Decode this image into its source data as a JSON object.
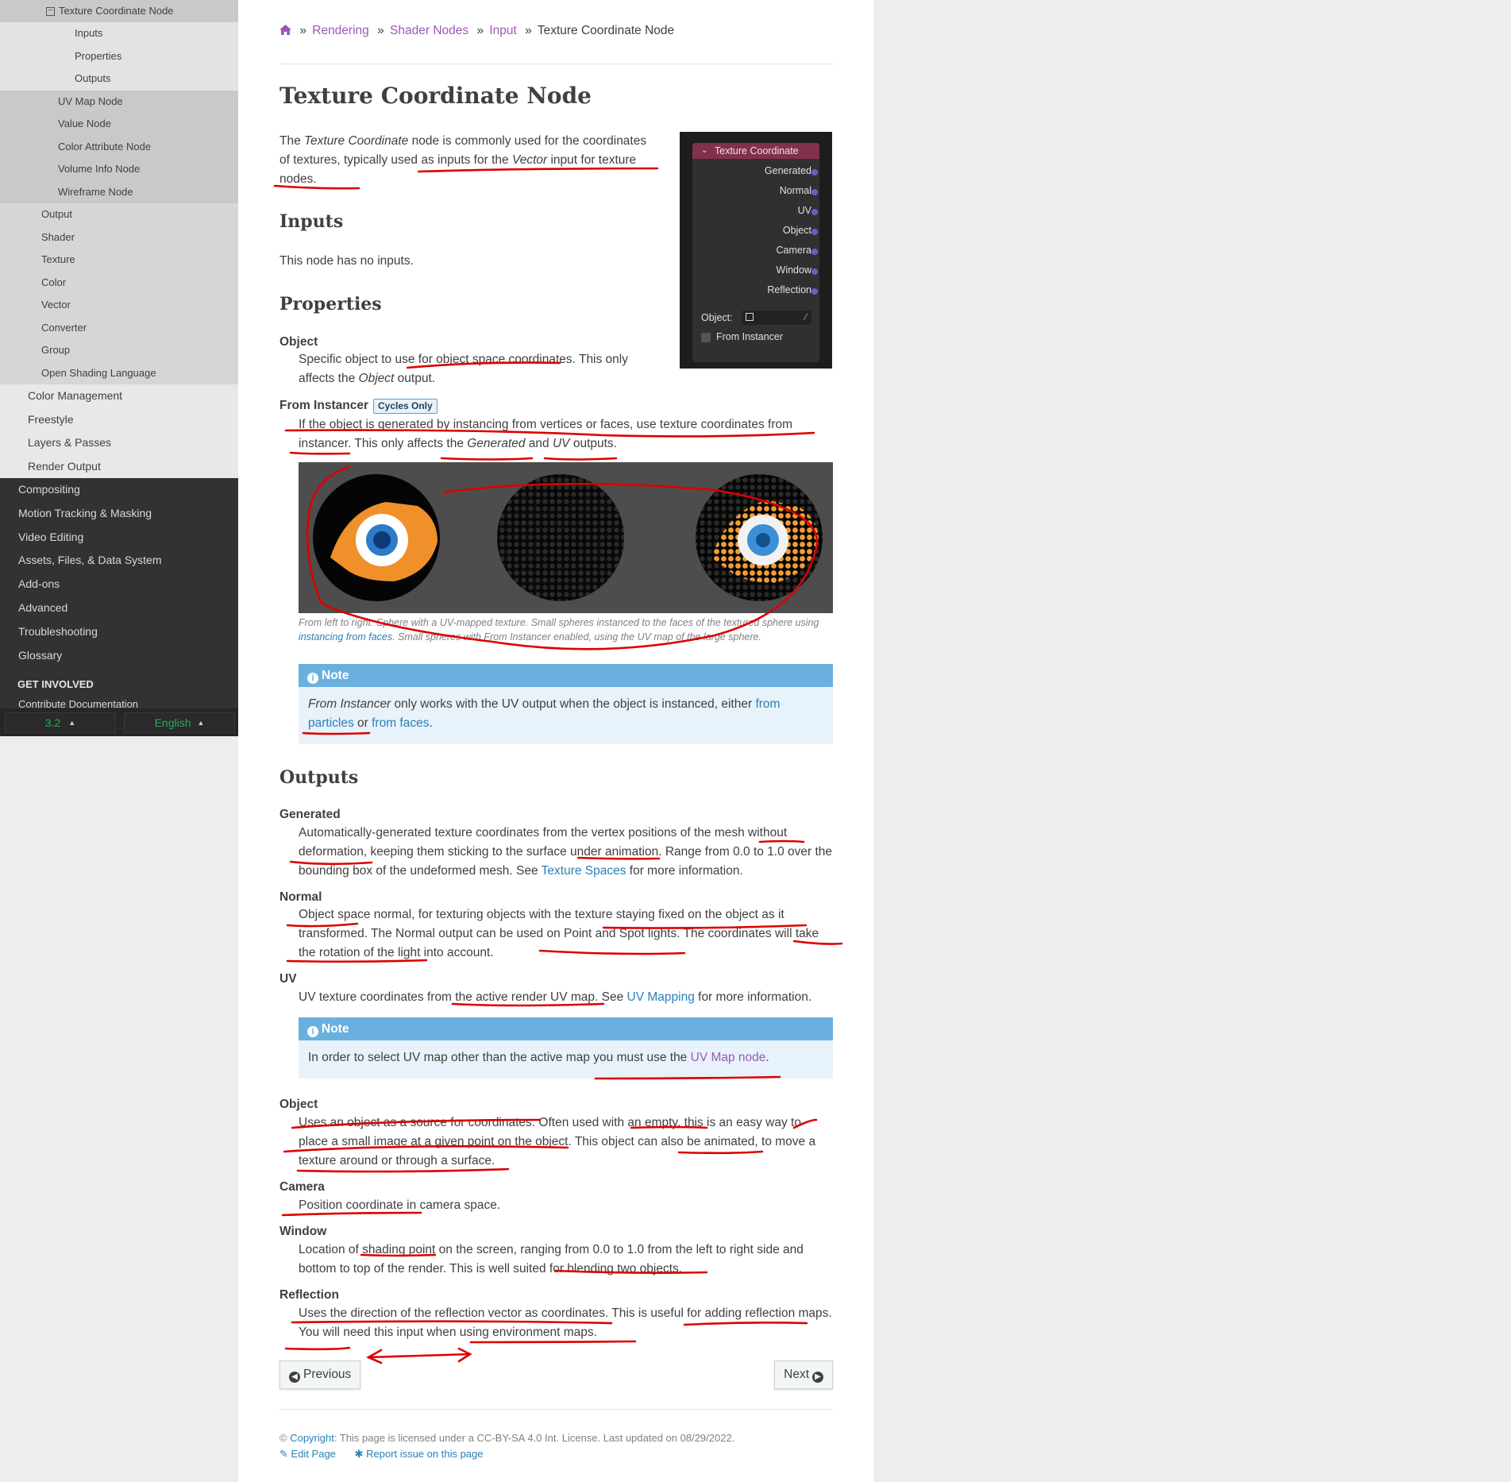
{
  "sidebar": {
    "current": "Texture Coordinate Node",
    "current_children": [
      "Inputs",
      "Properties",
      "Outputs"
    ],
    "siblings": [
      "UV Map Node",
      "Value Node",
      "Color Attribute Node",
      "Volume Info Node",
      "Wireframe Node"
    ],
    "shader_sections": [
      "Output",
      "Shader",
      "Texture",
      "Color",
      "Vector",
      "Converter",
      "Group",
      "Open Shading Language"
    ],
    "rendering_sections": [
      "Color Management",
      "Freestyle",
      "Layers & Passes",
      "Render Output"
    ],
    "top_sections": [
      "Compositing",
      "Motion Tracking & Masking",
      "Video Editing",
      "Assets, Files, & Data System",
      "Add-ons",
      "Advanced",
      "Troubleshooting",
      "Glossary"
    ],
    "caption": "GET INVOLVED",
    "cut_item": "Contribute Documentation",
    "version": "3.2",
    "language": "English"
  },
  "breadcrumb": {
    "sep": "»",
    "items": [
      "Rendering",
      "Shader Nodes",
      "Input"
    ],
    "current": "Texture Coordinate Node"
  },
  "title": "Texture Coordinate Node",
  "intro": {
    "t1": "The ",
    "em1": "Texture Coordinate",
    "t2": " node is commonly used for the coordinates of textures, typically used as inputs for the ",
    "em2": "Vector",
    "t3": " input for texture nodes."
  },
  "node_panel": {
    "header": "Texture Coordinate",
    "sockets": [
      "Generated",
      "Normal",
      "UV",
      "Object",
      "Camera",
      "Window",
      "Reflection"
    ],
    "object_label": "Object:",
    "checkbox_label": "From Instancer"
  },
  "inputs": {
    "heading": "Inputs",
    "text": "This node has no inputs."
  },
  "properties": {
    "heading": "Properties",
    "object_term": "Object",
    "object_t1": "Specific object to use for object space coordinates. This only affects the ",
    "object_em": "Object",
    "object_t2": " output.",
    "instancer_term": "From Instancer",
    "instancer_badge": "Cycles Only",
    "instancer_t1": "If the object is generated by instancing from vertices or faces, use texture coordinates from instancer. This only affects the ",
    "instancer_em1": "Generated",
    "instancer_and": " and ",
    "instancer_em2": "UV",
    "instancer_t2": " outputs.",
    "caption_t1": "From left to right: Sphere with a UV-mapped texture. Small spheres instanced to the faces of the textured sphere using ",
    "caption_link": "instancing from faces",
    "caption_t2": ". Small spheres with From Instancer enabled, using the UV map of the large sphere."
  },
  "note1": {
    "title": "Note",
    "em": "From Instancer",
    "t1": " only works with the UV output when the object is instanced, either ",
    "link1": "from particles",
    "or": " or ",
    "link2": "from faces",
    "end": "."
  },
  "outputs": {
    "heading": "Outputs",
    "generated_term": "Generated",
    "generated_t1": "Automatically-generated texture coordinates from the vertex positions of the mesh without deformation, keeping them sticking to the surface under animation. Range from 0.0 to 1.0 over the bounding box of the undeformed mesh. See ",
    "generated_link": "Texture Spaces",
    "generated_t2": " for more information.",
    "normal_term": "Normal",
    "normal_text": "Object space normal, for texturing objects with the texture staying fixed on the object as it transformed. The Normal output can be used on Point and Spot lights. The coordinates will take the rotation of the light into account.",
    "uv_term": "UV",
    "uv_t1": "UV texture coordinates from the active render UV map. See ",
    "uv_link": "UV Mapping",
    "uv_t2": " for more information.",
    "object_term": "Object",
    "object_text": "Uses an object as a source for coordinates. Often used with an empty, this is an easy way to place a small image at a given point on the object. This object can also be animated, to move a texture around or through a surface.",
    "camera_term": "Camera",
    "camera_text": "Position coordinate in camera space.",
    "window_term": "Window",
    "window_text": "Location of shading point on the screen, ranging from 0.0 to 1.0 from the left to right side and bottom to top of the render. This is well suited for blending two objects.",
    "reflection_term": "Reflection",
    "reflection_text": "Uses the direction of the reflection vector as coordinates. This is useful for adding reflection maps. You will need this input when using environment maps."
  },
  "note2": {
    "title": "Note",
    "t1": "In order to select UV map other than the active map you must use the ",
    "link": "UV Map node",
    "end": "."
  },
  "nav": {
    "previous": "Previous",
    "next": "Next"
  },
  "footer": {
    "copyright_link": "Copyright",
    "license": ": This page is licensed under a CC-BY-SA 4.0 Int. License. Last updated on 08/29/2022.",
    "edit": "Edit Page",
    "report": "Report issue on this page"
  },
  "colors": {
    "link": "#2980b9",
    "visited_link": "#9b59b6",
    "note_header": "#6ab0de",
    "annotation_ink": "#dd0000",
    "node_header": "#83314a"
  }
}
